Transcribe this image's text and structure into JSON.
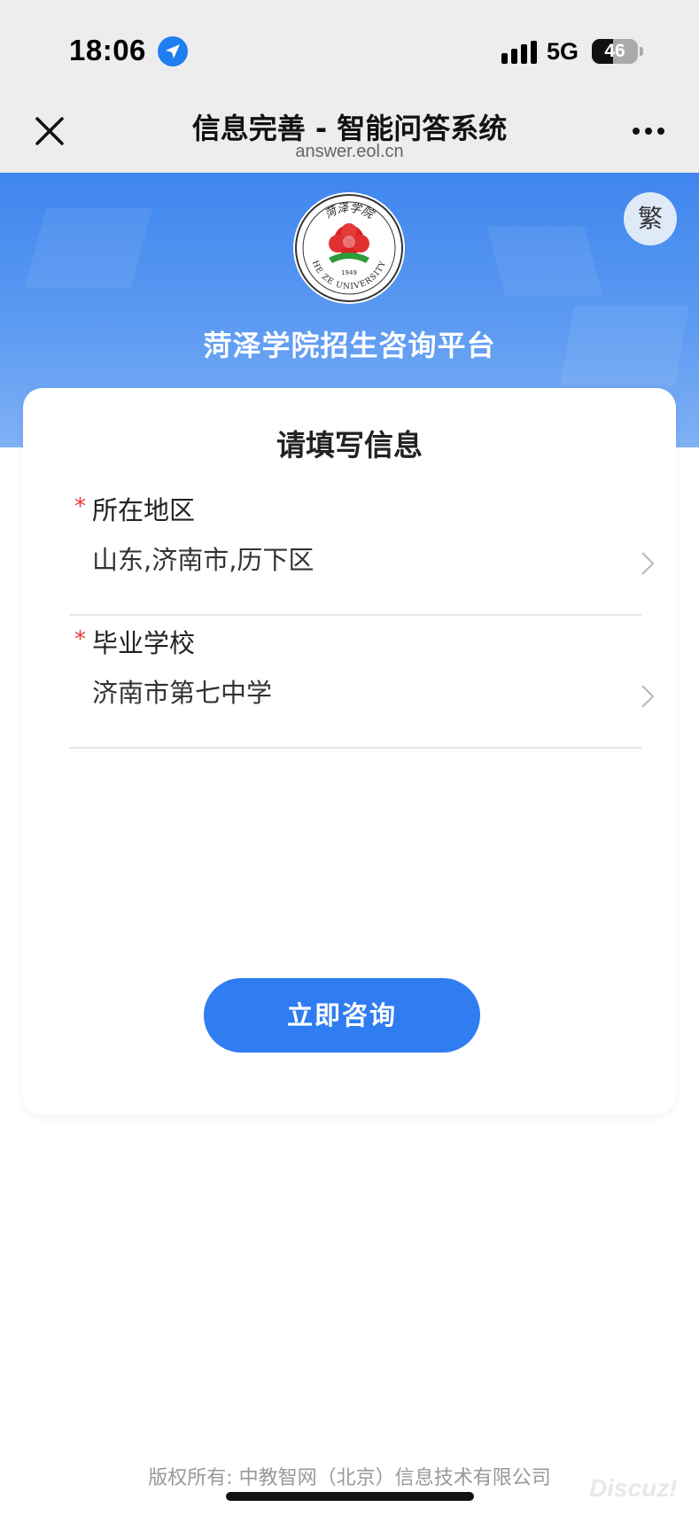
{
  "status_bar": {
    "time": "18:06",
    "network": "5G",
    "battery_level": "46",
    "battery_fraction": 0.46,
    "location_icon": "location-arrow-icon",
    "signal_icon": "signal-bars-icon"
  },
  "nav": {
    "title": "信息完善 - 智能问答系统",
    "subtitle": "answer.eol.cn",
    "close_icon": "close-icon",
    "more_icon": "more-dots-icon"
  },
  "hero": {
    "language_toggle": "繁",
    "platform_title": "菏泽学院招生咨询平台",
    "logo_top_text": "菏泽学院",
    "logo_bottom_text": "HE ZE UNIVERSITY",
    "logo_year": "1949"
  },
  "form": {
    "title": "请填写信息",
    "required_mark": "*",
    "fields": [
      {
        "label": "所在地区",
        "value": "山东,济南市,历下区"
      },
      {
        "label": "毕业学校",
        "value": "济南市第七中学"
      }
    ],
    "submit_label": "立即咨询"
  },
  "footer": {
    "copyright": "版权所有: 中教智网（北京）信息技术有限公司",
    "watermark": "Discuz!"
  },
  "colors": {
    "accent": "#2f7df1",
    "hero_top": "#3f86ee",
    "required": "#e53935"
  }
}
